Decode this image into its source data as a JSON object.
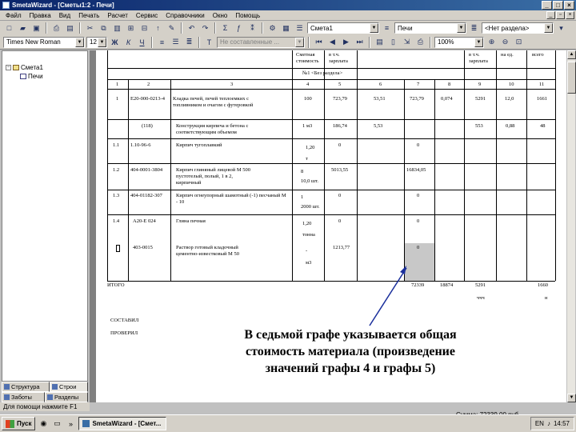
{
  "window": {
    "title": "SmetaWizard - [Сметы1:2 - Печи]",
    "buttons": {
      "minimize": "_",
      "maximize": "□",
      "close": "×"
    },
    "mdi_buttons": {
      "minimize": "_",
      "restore": "▫",
      "close": "×"
    }
  },
  "menu": [
    "Файл",
    "Правка",
    "Вид",
    "Печать",
    "Расчет",
    "Сервис",
    "Справочники",
    "Окно",
    "Помощь"
  ],
  "toolbar1": {
    "estimate_combo": "Смета1",
    "section_combo": "Печи",
    "section_filter_combo": "<Нет раздела>"
  },
  "toolbar2": {
    "font_combo": "Times New Roman",
    "size_combo": "12",
    "bold": "Ж",
    "italic": "К",
    "underline": "Ч",
    "style_combo": "Не составленные ...",
    "zoom_combo": "100%"
  },
  "tree": [
    {
      "label": "Смета1",
      "level": 0
    },
    {
      "label": "Печи",
      "level": 1
    }
  ],
  "panel_tabs": [
    {
      "label": "Структура"
    },
    {
      "label": "Строи"
    },
    {
      "label": "Заботы"
    },
    {
      "label": "Разделы"
    }
  ],
  "document": {
    "header_cols": [
      {
        "text": "Сметная\nстоимость",
        "col": 4
      },
      {
        "text": "в т.ч.\nзарплата",
        "col": 5
      },
      {
        "text": "в т.ч.\nзарплата",
        "col": 9
      },
      {
        "text": "на ед.",
        "col": 10
      },
      {
        "text": "всего",
        "col": 11
      }
    ],
    "section_title": "№1 <Без раздела>",
    "col_numbers": [
      "1",
      "2",
      "3",
      "4",
      "5",
      "6",
      "7",
      "8",
      "9",
      "10",
      "11"
    ],
    "rows": [
      {
        "n": "1",
        "code": "Е20-000-0213-4",
        "name": "Кладка печей, печей теплоемких с\nтопливником и очагом с футеровкой",
        "qty": "100",
        "c5": "723,79",
        "c6": "53,51",
        "c7": "723,79",
        "c8": "0,074",
        "c9": "5291",
        "c10": "12,0",
        "c11": "1661"
      },
      {
        "n": "",
        "code": "(118)",
        "name": "Конструкция кирпича и бетона с\nсоответствующим объемом",
        "qty": "1 м3",
        "c5": "186,74",
        "c6": "5,53",
        "c7": "",
        "c8": "",
        "c9": "553",
        "c10": "0,88",
        "c11": "48"
      },
      {
        "n": "1.1",
        "code": "1.10-96-6",
        "name": "Кирпич тугоплавкий",
        "qty": "1,20\nт",
        "c5": "0",
        "c6": "",
        "c7": "0",
        "c8": "",
        "c9": "",
        "c10": "",
        "c11": ""
      },
      {
        "n": "1.2",
        "code": "404-0001-3804",
        "name": "Кирпич глиняный лицевой М 500\nпустотелый, полый, 1 в 2,\nкирпичный",
        "qty": "8\n10,0 шт.",
        "c5": "5013,55",
        "c6": "",
        "c7": "16834,05",
        "c8": "",
        "c9": "",
        "c10": "",
        "c11": ""
      },
      {
        "n": "1.3",
        "code": "404-01182-307",
        "name": "Кирпич огнеупорный шамотный (-1) песчаный М\n- 10",
        "qty": "1\n2000 шт.",
        "c5": "0",
        "c6": "",
        "c7": "0",
        "c8": "",
        "c9": "",
        "c10": "",
        "c11": ""
      },
      {
        "n": "1.4",
        "code": "А20-Е 024",
        "name": "Глина печная",
        "qty": "1,20\nтонна",
        "c5": "0",
        "c6": "",
        "c7": "0",
        "c8": "",
        "c9": "",
        "c10": "",
        "c11": ""
      },
      {
        "n": "",
        "code": "403-0015",
        "name": "Раствор готовый кладочный\nцементно-известковый М 50",
        "qty": "-\nм3",
        "c5": "1213,77",
        "c6": "",
        "c7": "0",
        "c8": "",
        "c9": "",
        "c10": "",
        "c11": ""
      }
    ],
    "total_label": "ИТОГО",
    "total_values": {
      "c7": "72339",
      "c8": "18874",
      "c9": "5291",
      "c11": "1660"
    },
    "total_sub": {
      "c9": "ччч",
      "c11": "н"
    },
    "signature_composed": "СОСТАВИЛ",
    "signature_checked": "ПРОВЕРИЛ"
  },
  "callout": "В седьмой графе указывается общая\nстоимость материала (произведение\nзначений графы 4 и графы 5)",
  "status": {
    "left": "Для помощи нажмите F1",
    "right": "Сумма: 72339,00 руб."
  },
  "taskbar": {
    "start": "Пуск",
    "task": "SmetaWizard - [Смет...",
    "clock": "14:57"
  }
}
